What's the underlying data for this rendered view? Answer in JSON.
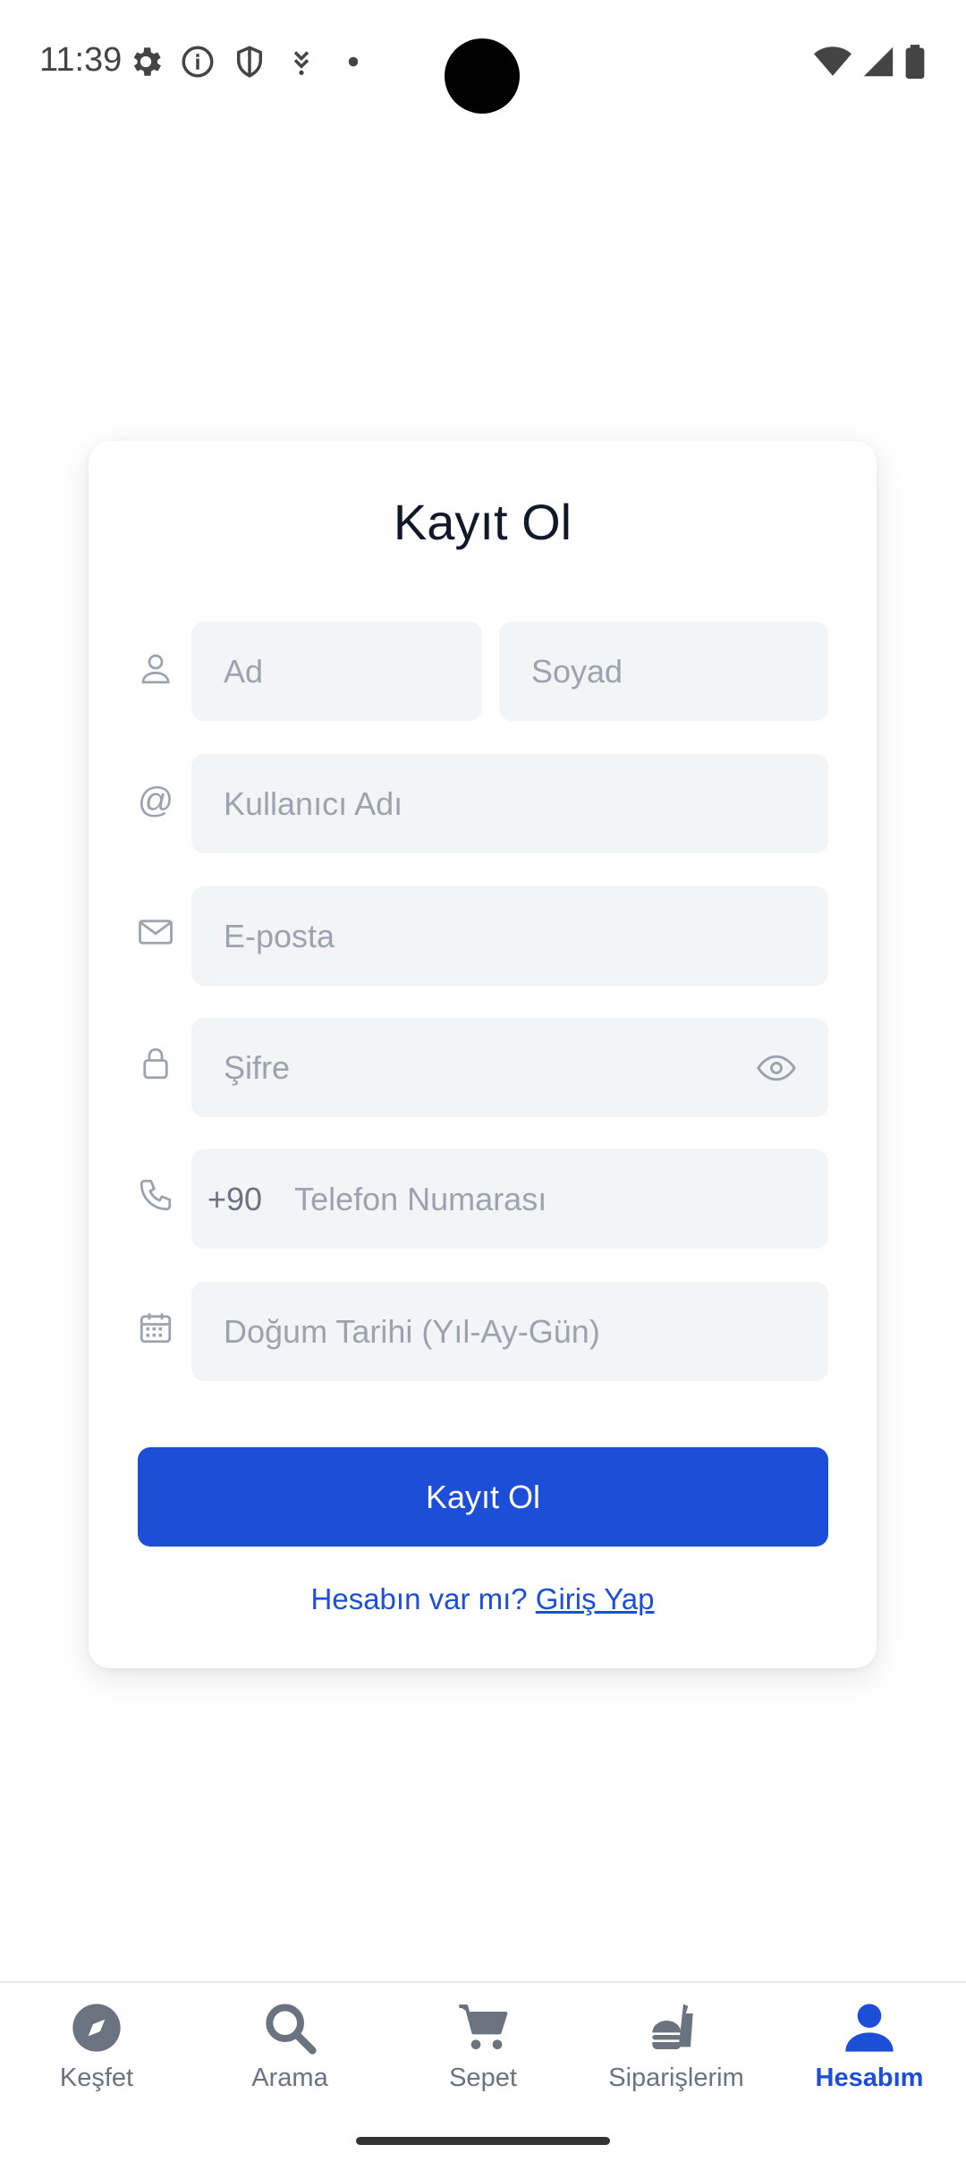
{
  "status": {
    "time": "11:39"
  },
  "form": {
    "title": "Kayıt Ol",
    "first_name_placeholder": "Ad",
    "last_name_placeholder": "Soyad",
    "username_placeholder": "Kullanıcı Adı",
    "email_placeholder": "E-posta",
    "password_placeholder": "Şifre",
    "phone_prefix": "+90",
    "phone_placeholder": "Telefon Numarası",
    "birthdate_placeholder": "Doğum Tarihi (Yıl-Ay-Gün)",
    "submit_label": "Kayıt Ol",
    "login_prompt": "Hesabın var mı?",
    "login_link": "Giriş Yap"
  },
  "nav": {
    "items": [
      {
        "label": "Keşfet",
        "icon": "compass-icon"
      },
      {
        "label": "Arama",
        "icon": "search-icon"
      },
      {
        "label": "Sepet",
        "icon": "cart-icon"
      },
      {
        "label": "Siparişlerim",
        "icon": "takeaway-icon"
      },
      {
        "label": "Hesabım",
        "icon": "user-icon",
        "active": true
      }
    ]
  },
  "colors": {
    "accent": "#1d4ed8",
    "field_bg": "#f3f4f6",
    "placeholder": "#9ca3af"
  }
}
